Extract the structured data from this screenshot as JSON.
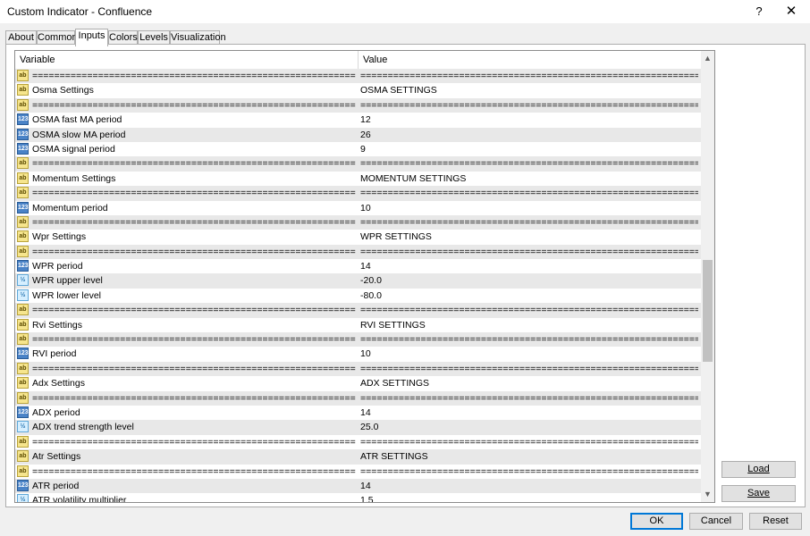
{
  "window": {
    "title": "Custom Indicator - Confluence",
    "help_label": "?",
    "close_label": "✕"
  },
  "tabs": [
    {
      "label": "About",
      "active": false
    },
    {
      "label": "Common",
      "active": false
    },
    {
      "label": "Inputs",
      "active": true
    },
    {
      "label": "Colors",
      "active": false
    },
    {
      "label": "Levels",
      "active": false
    },
    {
      "label": "Visualization",
      "active": false
    }
  ],
  "grid": {
    "headers": {
      "variable": "Variable",
      "value": "Value"
    },
    "rows": [
      {
        "icon": "ab",
        "variable": "================================================================",
        "value": "================================================================"
      },
      {
        "icon": "ab",
        "variable": "Osma Settings",
        "value": "OSMA SETTINGS"
      },
      {
        "icon": "ab",
        "variable": "================================================================",
        "value": "================================================================"
      },
      {
        "icon": "123",
        "variable": "OSMA fast MA period",
        "value": "12"
      },
      {
        "icon": "123",
        "variable": "OSMA slow MA period",
        "value": "26"
      },
      {
        "icon": "123",
        "variable": "OSMA signal period",
        "value": "9"
      },
      {
        "icon": "ab",
        "variable": "================================================================",
        "value": "================================================================"
      },
      {
        "icon": "ab",
        "variable": "Momentum Settings",
        "value": "MOMENTUM SETTINGS"
      },
      {
        "icon": "ab",
        "variable": "================================================================",
        "value": "================================================================"
      },
      {
        "icon": "123",
        "variable": "Momentum period",
        "value": "10"
      },
      {
        "icon": "ab",
        "variable": "================================================================",
        "value": "================================================================"
      },
      {
        "icon": "ab",
        "variable": "Wpr Settings",
        "value": "WPR SETTINGS"
      },
      {
        "icon": "ab",
        "variable": "================================================================",
        "value": "================================================================"
      },
      {
        "icon": "123",
        "variable": "WPR period",
        "value": "14"
      },
      {
        "icon": "frac",
        "variable": "WPR upper level",
        "value": "-20.0"
      },
      {
        "icon": "frac",
        "variable": "WPR lower level",
        "value": "-80.0"
      },
      {
        "icon": "ab",
        "variable": "================================================================",
        "value": "================================================================"
      },
      {
        "icon": "ab",
        "variable": "Rvi Settings",
        "value": "RVI SETTINGS"
      },
      {
        "icon": "ab",
        "variable": "================================================================",
        "value": "================================================================"
      },
      {
        "icon": "123",
        "variable": "RVI period",
        "value": "10"
      },
      {
        "icon": "ab",
        "variable": "================================================================",
        "value": "================================================================"
      },
      {
        "icon": "ab",
        "variable": "Adx Settings",
        "value": "ADX SETTINGS"
      },
      {
        "icon": "ab",
        "variable": "================================================================",
        "value": "================================================================"
      },
      {
        "icon": "123",
        "variable": "ADX period",
        "value": "14"
      },
      {
        "icon": "frac",
        "variable": "ADX trend strength level",
        "value": "25.0"
      },
      {
        "icon": "ab",
        "variable": "================================================================",
        "value": "================================================================"
      },
      {
        "icon": "ab",
        "variable": "Atr Settings",
        "value": "ATR SETTINGS"
      },
      {
        "icon": "ab",
        "variable": "================================================================",
        "value": "================================================================"
      },
      {
        "icon": "123",
        "variable": "ATR period",
        "value": "14"
      },
      {
        "icon": "frac",
        "variable": "ATR volatility multiplier",
        "value": "1.5"
      }
    ]
  },
  "icons": {
    "ab": {
      "glyph": "ab",
      "name": "string-type-icon"
    },
    "123": {
      "glyph": "123",
      "name": "integer-type-icon"
    },
    "frac": {
      "glyph": "½",
      "name": "double-type-icon"
    }
  },
  "side_buttons": {
    "load": "Load",
    "save": "Save"
  },
  "footer": {
    "ok": "OK",
    "cancel": "Cancel",
    "reset": "Reset"
  },
  "scroll_position": 0.62
}
